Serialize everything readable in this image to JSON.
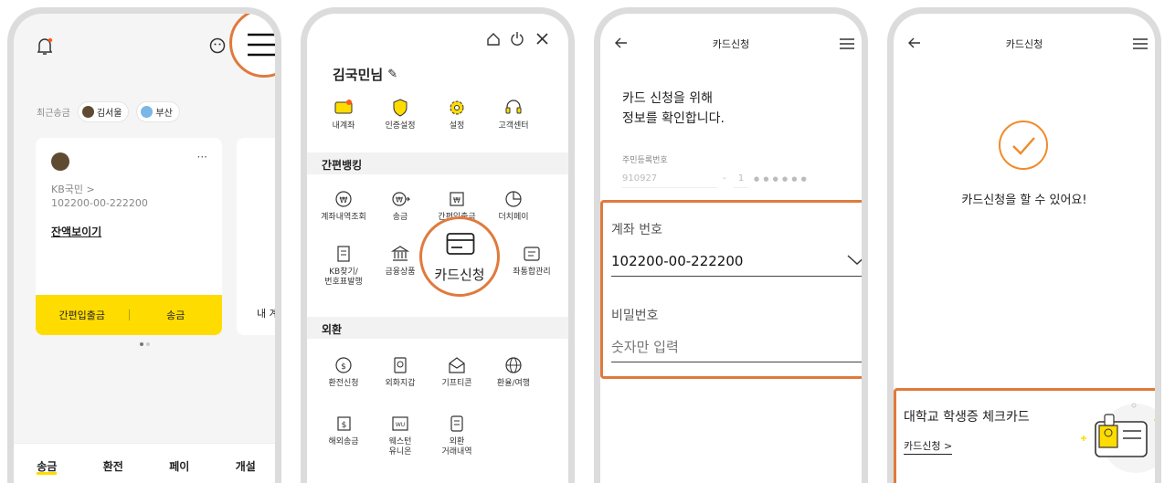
{
  "screen1": {
    "recent_label": "최근송금",
    "chips": [
      "김서울",
      "부산"
    ],
    "card": {
      "bank": "KB국민 >",
      "account": "102200-00-222200",
      "balance_link": "잔액보이기",
      "more": "···",
      "btn_left": "간편입출금",
      "btn_right": "송금"
    },
    "peek_label": "내 계",
    "nav": [
      "송금",
      "환전",
      "페이",
      "개설"
    ]
  },
  "screen2": {
    "user": "김국민님",
    "top_items": [
      "내계좌",
      "인증설정",
      "설정",
      "고객센터"
    ],
    "section1": "간편뱅킹",
    "s1_items": [
      "계좌내역조회",
      "송금",
      "간편입출금",
      "더치페이",
      "KB찾기/\n번호표발행",
      "금융상품",
      "좌통합관리"
    ],
    "card_apply": "카드신청",
    "section2": "외환",
    "s2_items": [
      "환전신청",
      "외화지갑",
      "기프티콘",
      "환율/여행",
      "해외송금",
      "웨스턴\n유니온",
      "외환\n거래내역"
    ]
  },
  "screen3": {
    "title": "카드신청",
    "heading1": "카드 신청을 위해",
    "heading2": "정보를 확인합니다.",
    "rrn_label": "주민등록번호",
    "rrn_front": "910927",
    "rrn_dash": "-",
    "rrn_first": "1",
    "rrn_mask": "● ● ● ● ● ●",
    "account_label": "계좌 번호",
    "account_value": "102200-00-222200",
    "pw_label": "비밀번호",
    "pw_placeholder": "숫자만 입력"
  },
  "screen4": {
    "title": "카드신청",
    "message": "카드신청을 할 수 있어요!",
    "promo_title": "대학교 학생증 체크카드",
    "promo_link": "카드신청 >"
  },
  "colors": {
    "accent_yellow": "#ffdc00",
    "orange": "#e07a3c",
    "dark_text": "#222222"
  }
}
